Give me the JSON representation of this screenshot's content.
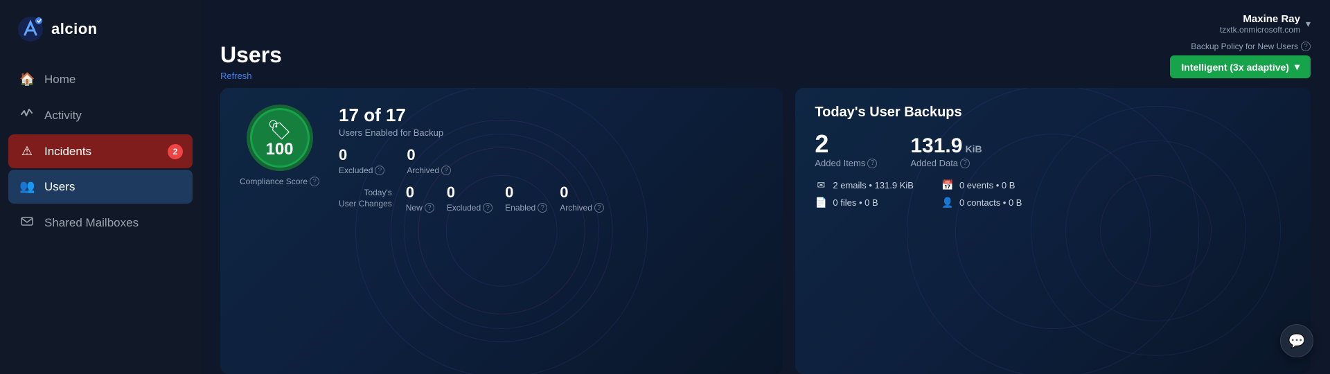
{
  "sidebar": {
    "logo_text": "alcion",
    "nav_items": [
      {
        "id": "home",
        "label": "Home",
        "icon": "🏠",
        "active": false
      },
      {
        "id": "activity",
        "label": "Activity",
        "icon": "📈",
        "active": false
      },
      {
        "id": "incidents",
        "label": "Incidents",
        "icon": "⚠",
        "active": true,
        "badge": "2"
      },
      {
        "id": "users",
        "label": "Users",
        "icon": "👥",
        "active": true
      },
      {
        "id": "shared-mailboxes",
        "label": "Shared Mailboxes",
        "icon": "📧",
        "active": false
      }
    ]
  },
  "header": {
    "user_name": "Maxine Ray",
    "user_email": "tzxtk.onmicrosoft.com",
    "backup_policy_label": "Backup Policy for New Users",
    "backup_policy_btn": "Intelligent (3x adaptive)"
  },
  "page": {
    "title": "Users",
    "refresh_label": "Refresh"
  },
  "left_card": {
    "score": "100",
    "score_label": "Compliance Score",
    "users_count": "17",
    "users_total": "17",
    "users_enabled_label": "Users Enabled for Backup",
    "excluded": "0",
    "excluded_label": "Excluded",
    "archived": "0",
    "archived_label": "Archived",
    "today_changes_label": "Today's\nUser Changes",
    "new": "0",
    "new_label": "New",
    "excluded2": "0",
    "excluded2_label": "Excluded",
    "enabled": "0",
    "enabled_label": "Enabled",
    "archived2": "0",
    "archived2_label": "Archived"
  },
  "right_card": {
    "title": "Today's User Backups",
    "added_items": "2",
    "added_items_label": "Added Items",
    "added_data_value": "131.9",
    "added_data_unit": "KiB",
    "added_data_label": "Added Data",
    "details": [
      {
        "icon": "✉",
        "text": "2 emails • 131.9 KiB"
      },
      {
        "icon": "📄",
        "text": "0 files • 0 B"
      }
    ],
    "details_right": [
      {
        "icon": "📅",
        "text": "0 events • 0 B"
      },
      {
        "icon": "👤",
        "text": "0 contacts • 0 B"
      }
    ]
  },
  "chat": {
    "icon": "💬"
  }
}
